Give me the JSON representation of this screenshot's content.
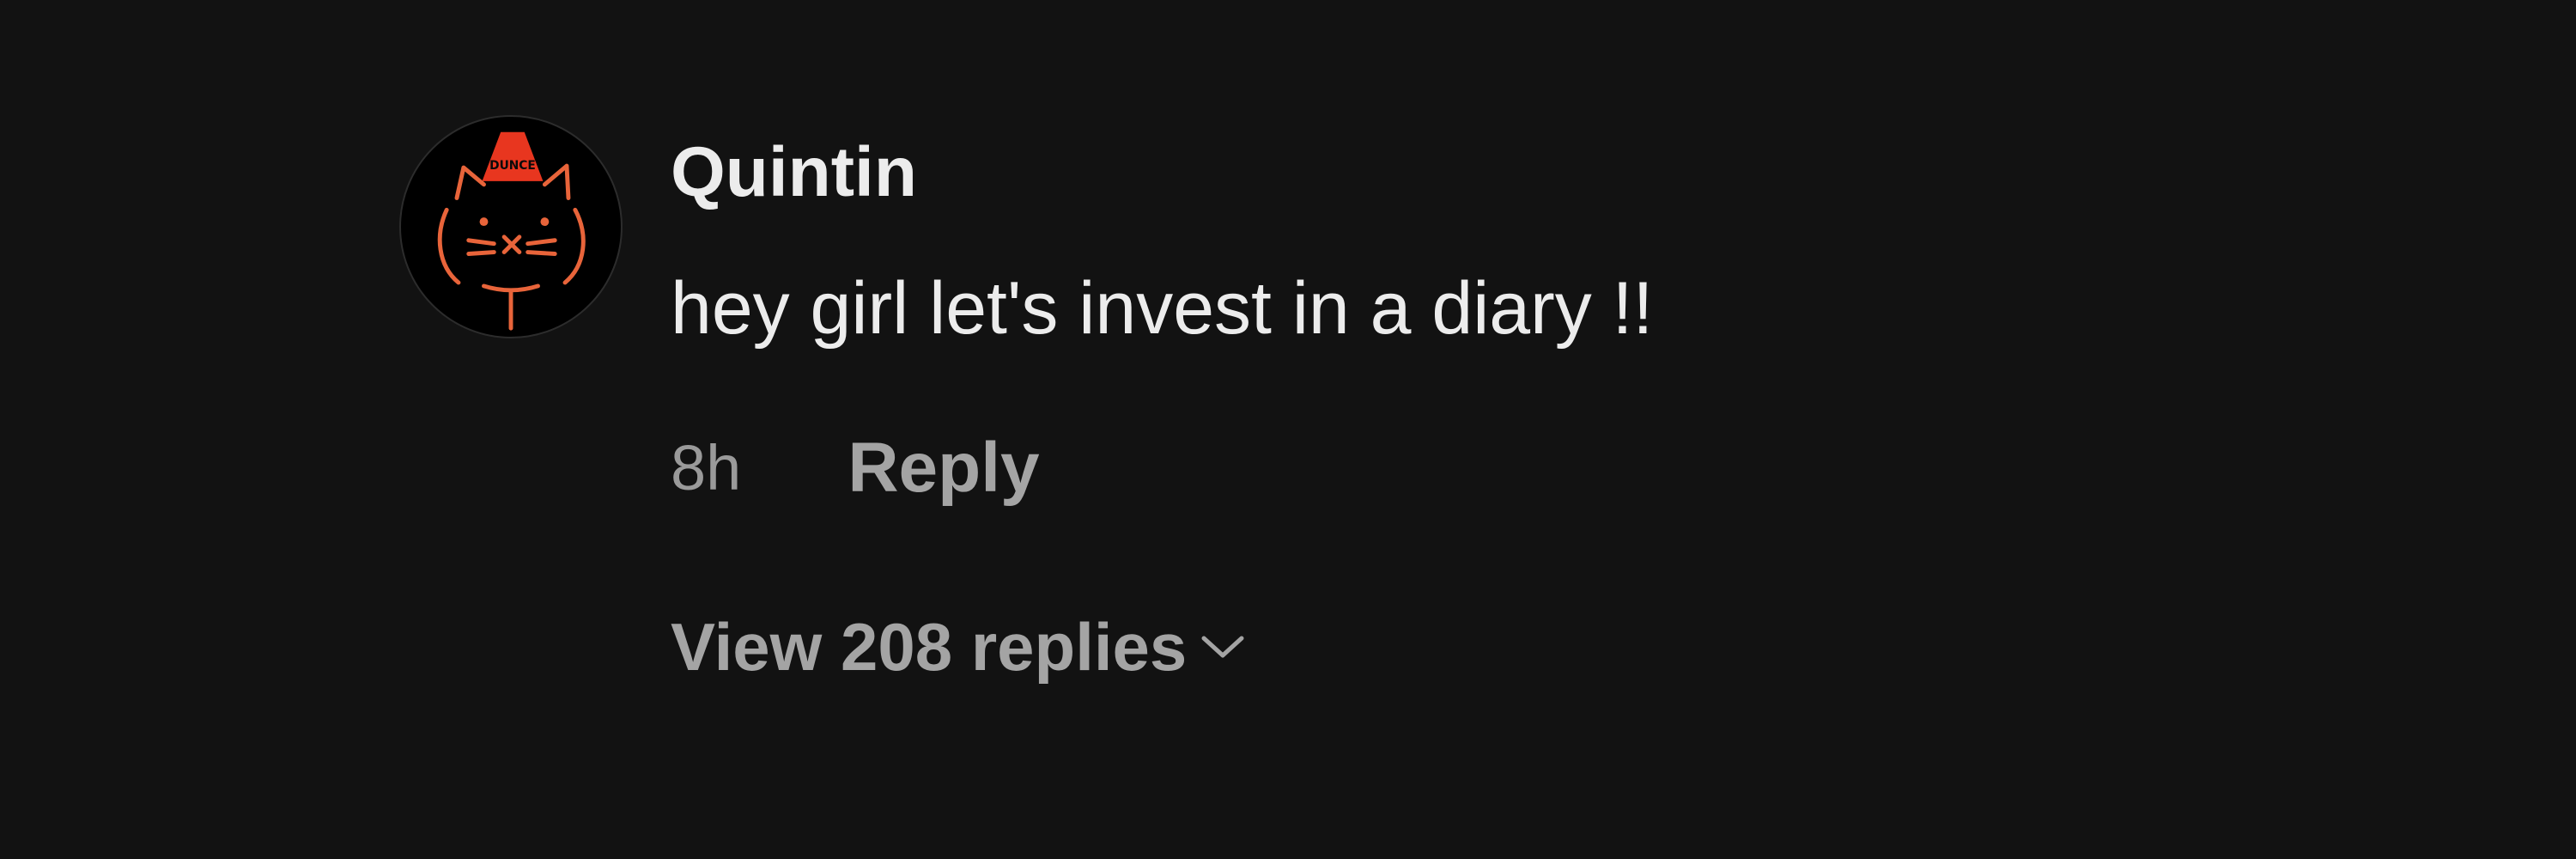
{
  "comment": {
    "avatar_icon": "cat-with-dunce-cap-icon",
    "avatar_text": "DUNCE",
    "username": "Quintin",
    "text": "hey girl let's invest in a diary !!",
    "timestamp": "8h",
    "reply_label": "Reply",
    "view_replies_label": "View 208 replies",
    "view_replies_icon": "chevron-down-icon"
  },
  "colors": {
    "background": "#121212",
    "primary_text": "#ececec",
    "secondary_text": "#a4a4a4",
    "avatar_background": "#000000",
    "avatar_drawing": "#e8643a",
    "avatar_hat": "#e8361f"
  }
}
